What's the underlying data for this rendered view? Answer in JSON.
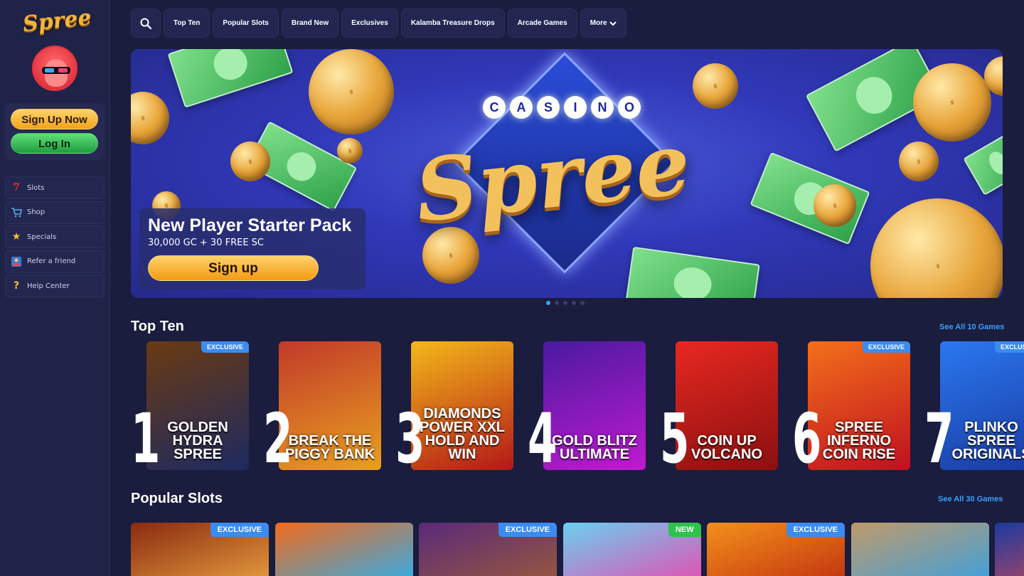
{
  "brand": {
    "logo_text": "Spree"
  },
  "auth": {
    "signup_label": "Sign Up Now",
    "login_label": "Log In"
  },
  "sidebar": {
    "items": [
      {
        "label": "Slots",
        "icon": "seven-icon"
      },
      {
        "label": "Shop",
        "icon": "cart-icon"
      },
      {
        "label": "Specials",
        "icon": "star-icon"
      },
      {
        "label": "Refer a friend",
        "icon": "friend-icon"
      },
      {
        "label": "Help Center",
        "icon": "question-icon"
      }
    ]
  },
  "topnav": {
    "tabs": [
      "Top Ten",
      "Popular Slots",
      "Brand New",
      "Exclusives",
      "Kalamba Treasure Drops",
      "Arcade Games",
      "More"
    ]
  },
  "hero": {
    "casino_letters": [
      "C",
      "A",
      "S",
      "I",
      "N",
      "O"
    ],
    "logo_word": "Spree",
    "title": "New Player Starter Pack",
    "subtitle": "30,000 GC + 30 FREE SC",
    "cta": "Sign up",
    "slide_count": 5,
    "active_slide": 1
  },
  "top_ten": {
    "title": "Top Ten",
    "see_all": "See All 10 Games",
    "games": [
      {
        "rank": "1",
        "name": "GOLDEN HYDRA\nSPREE",
        "badge": "EXCLUSIVE",
        "colors": [
          "#6b3a12",
          "#1d2a60"
        ]
      },
      {
        "rank": "2",
        "name": "BREAK THE\nPIGGY BANK",
        "badge": "",
        "colors": [
          "#c23a2a",
          "#e8a020"
        ]
      },
      {
        "rank": "3",
        "name": "DIAMONDS\nPOWER XXL\nHOLD AND WIN",
        "badge": "",
        "colors": [
          "#f3b81a",
          "#b31818"
        ]
      },
      {
        "rank": "4",
        "name": "GOLD BLITZ\nULTIMATE",
        "badge": "",
        "colors": [
          "#4a1aa0",
          "#c01ad0"
        ]
      },
      {
        "rank": "5",
        "name": "COIN UP\nVOLCANO",
        "badge": "",
        "colors": [
          "#e82820",
          "#8a1010"
        ]
      },
      {
        "rank": "6",
        "name": "SPREE\nINFERNO\nCOIN RISE",
        "badge": "EXCLUSIVE",
        "colors": [
          "#f3701a",
          "#c01020"
        ]
      },
      {
        "rank": "7",
        "name": "PLINKO\nSPREE ORIGINALS",
        "badge": "EXCLUSIVE",
        "colors": [
          "#2a78f0",
          "#1a3aa0"
        ]
      }
    ]
  },
  "popular_slots": {
    "title": "Popular Slots",
    "see_all": "See All 30 Games",
    "games": [
      {
        "badge": "EXCLUSIVE",
        "colors": [
          "#8a2a10",
          "#e8a040"
        ]
      },
      {
        "badge": "",
        "colors": [
          "#f36a1a",
          "#2ab0f0"
        ]
      },
      {
        "badge": "EXCLUSIVE",
        "colors": [
          "#5a2a7a",
          "#9a5a3a"
        ]
      },
      {
        "badge": "NEW",
        "colors": [
          "#6ad0f0",
          "#e84ab0"
        ]
      },
      {
        "badge": "EXCLUSIVE",
        "colors": [
          "#f3901a",
          "#c03010"
        ]
      },
      {
        "badge": "",
        "colors": [
          "#c09a6a",
          "#3aa0e0"
        ]
      },
      {
        "badge": "",
        "colors": [
          "#1a3aa0",
          "#e84a4a"
        ]
      }
    ]
  }
}
